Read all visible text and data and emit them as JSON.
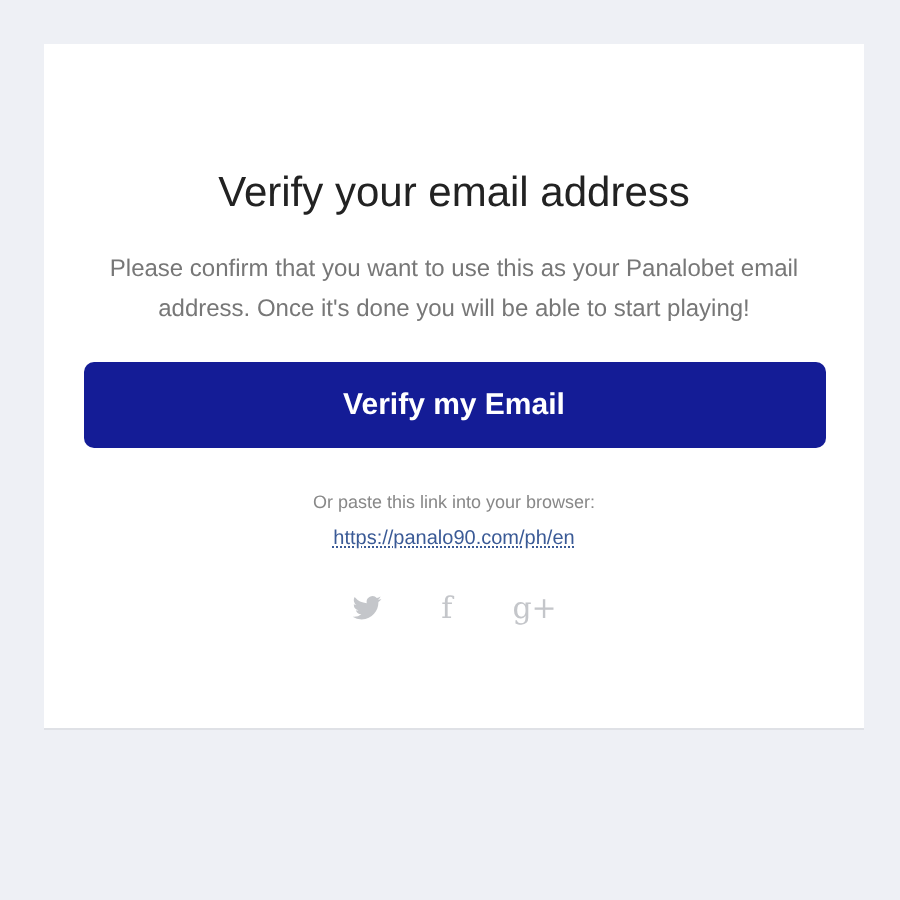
{
  "title": "Verify your email address",
  "message": "Please confirm that you want to use this as your Panalobet email address. Once it's done you will be able to start playing!",
  "button": "Verify my Email",
  "paste_hint": "Or paste this link into your browser:",
  "link": "https://panalo90.com/ph/en",
  "social": [
    {
      "kind": "bird"
    },
    {
      "kind": "glyph",
      "text": "f"
    },
    {
      "kind": "glyph",
      "text": "g+"
    }
  ]
}
